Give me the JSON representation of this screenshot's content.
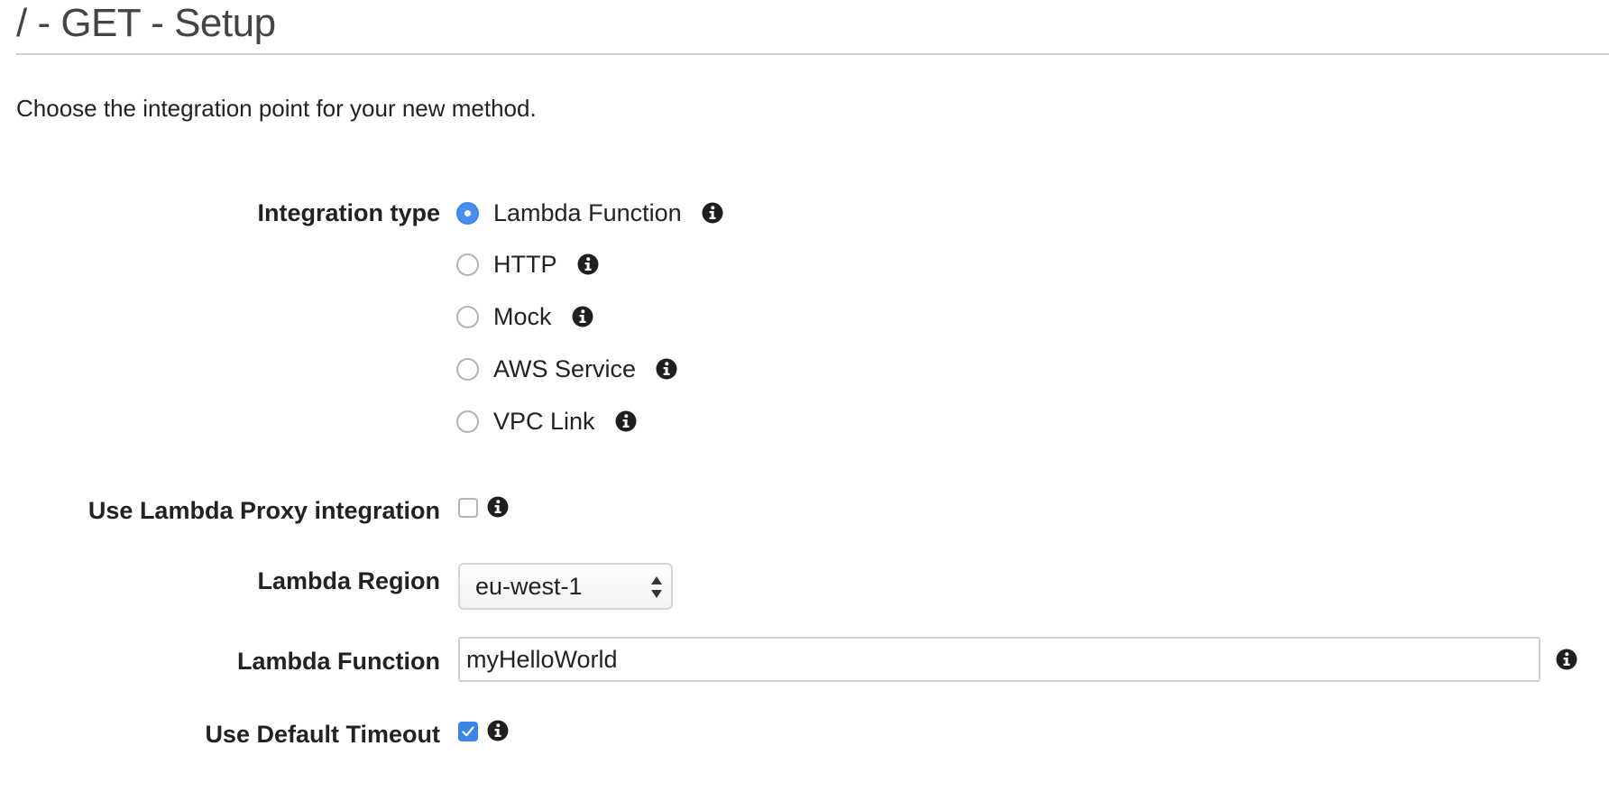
{
  "header": {
    "title": "/ - GET - Setup"
  },
  "intro_text": "Choose the integration point for your new method.",
  "integration_type": {
    "label": "Integration type",
    "options": [
      {
        "label": "Lambda Function",
        "selected": true
      },
      {
        "label": "HTTP",
        "selected": false
      },
      {
        "label": "Mock",
        "selected": false
      },
      {
        "label": "AWS Service",
        "selected": false
      },
      {
        "label": "VPC Link",
        "selected": false
      }
    ]
  },
  "lambda_proxy": {
    "label": "Use Lambda Proxy integration",
    "checked": false
  },
  "lambda_region": {
    "label": "Lambda Region",
    "value": "eu-west-1"
  },
  "lambda_function": {
    "label": "Lambda Function",
    "value": "myHelloWorld"
  },
  "default_timeout": {
    "label": "Use Default Timeout",
    "checked": true
  },
  "colors": {
    "accent": "#3b84e8",
    "text": "#222222",
    "title": "#444444",
    "border": "#cfcfcf"
  },
  "icons": {
    "info": "info-circle-icon",
    "select_arrows": "up-down-arrows-icon",
    "check": "checkmark-icon"
  }
}
